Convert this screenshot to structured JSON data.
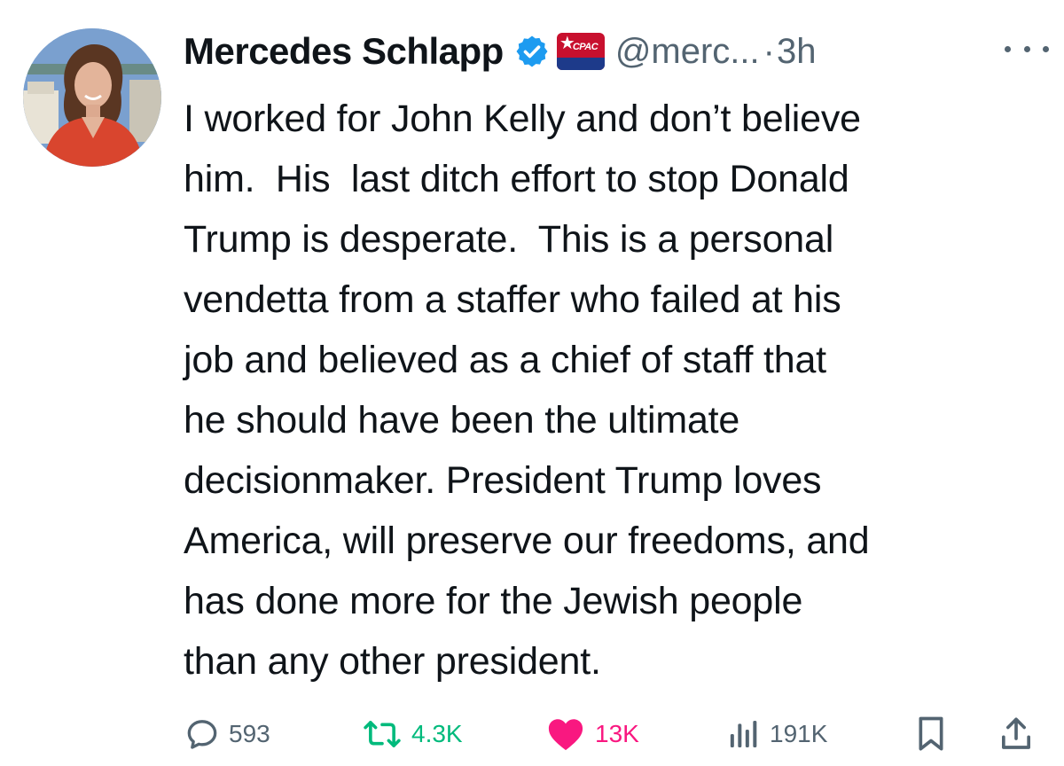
{
  "tweet": {
    "author_name": "Mercedes Schlapp",
    "handle": "@merc...",
    "separator": "·",
    "time": "3h",
    "affiliate_badge": "CPAC",
    "text": "I worked for John Kelly and don’t believe\nhim.  His  last ditch effort to stop Donald\nTrump is desperate.  This is a personal\nvendetta from a staffer who failed at his\njob and believed as a chief of staff that\nhe should have been the ultimate\ndecisionmaker. President Trump loves\nAmerica, will preserve our freedoms, and\nhas done more for the Jewish people\nthan any other president."
  },
  "actions": {
    "replies": "593",
    "reposts": "4.3K",
    "likes": "13K",
    "views": "191K"
  },
  "icons": {
    "verified": "verified-badge-icon",
    "more": "more-icon",
    "reply": "reply-icon",
    "repost": "repost-icon",
    "like": "heart-icon",
    "views": "views-icon",
    "bookmark": "bookmark-icon",
    "share": "share-icon"
  },
  "colors": {
    "text": "#0f1419",
    "secondary": "#536471",
    "verified": "#1d9bf0",
    "repost": "#00ba7c",
    "like": "#f91880",
    "cpac_red": "#c8102e",
    "cpac_blue": "#1d3a8a"
  }
}
